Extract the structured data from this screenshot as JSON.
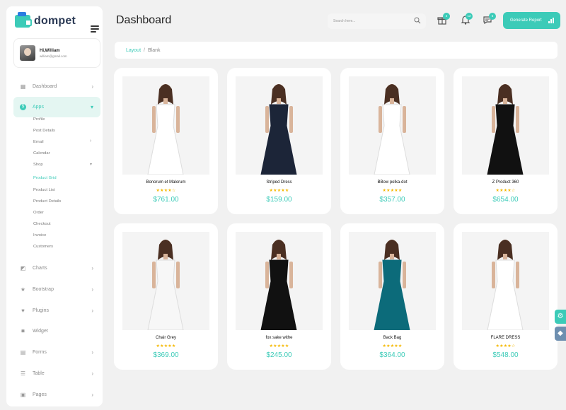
{
  "app": {
    "logo": "dompet"
  },
  "user": {
    "greeting_prefix": "Hi,",
    "name": "William",
    "email": "william@gmail.com"
  },
  "header": {
    "title": "Dashboard",
    "search_placeholder": "Search here...",
    "badges": [
      "2",
      "12",
      "5"
    ],
    "generate_label": "Generate Report"
  },
  "breadcrumb": {
    "first": "Layout",
    "sep": "/",
    "second": "Blank"
  },
  "nav": {
    "dashboard": "Dashboard",
    "apps": "Apps",
    "apps_sub": [
      "Profile",
      "Post Details",
      "Email",
      "Calendar",
      "Shop",
      "Product Grid",
      "Product List",
      "Product Details",
      "Order",
      "Checkout",
      "Invoice",
      "Customers"
    ],
    "charts": "Charts",
    "bootstrap": "Bootstrap",
    "plugins": "Plugins",
    "widget": "Widget",
    "forms": "Forms",
    "table": "Table",
    "pages": "Pages"
  },
  "products": [
    {
      "name": "Bonorum et Malorum",
      "price": "$761.00",
      "stars": "★★★★☆",
      "dress_color": "#ffffff"
    },
    {
      "name": "Striped Dress",
      "price": "$159.00",
      "stars": "★★★★★",
      "dress_color": "#1c2538"
    },
    {
      "name": "BBow polka-dot",
      "price": "$357.00",
      "stars": "★★★★★",
      "dress_color": "#ffffff"
    },
    {
      "name": "Z Product 360",
      "price": "$654.00",
      "stars": "★★★★☆",
      "dress_color": "#111111"
    },
    {
      "name": "Chair Grey",
      "price": "$369.00",
      "stars": "★★★★★",
      "dress_color": "#f7f7f7"
    },
    {
      "name": "fox sake withe",
      "price": "$245.00",
      "stars": "★★★★★",
      "dress_color": "#111111"
    },
    {
      "name": "Back Bag",
      "price": "$364.00",
      "stars": "★★★★★",
      "dress_color": "#0c6b7a"
    },
    {
      "name": "FLARE DRESS",
      "price": "$548.00",
      "stars": "★★★★☆",
      "dress_color": "#ffffff"
    }
  ],
  "colors": {
    "accent": "#3ccbb8",
    "star": "#f5b800"
  }
}
